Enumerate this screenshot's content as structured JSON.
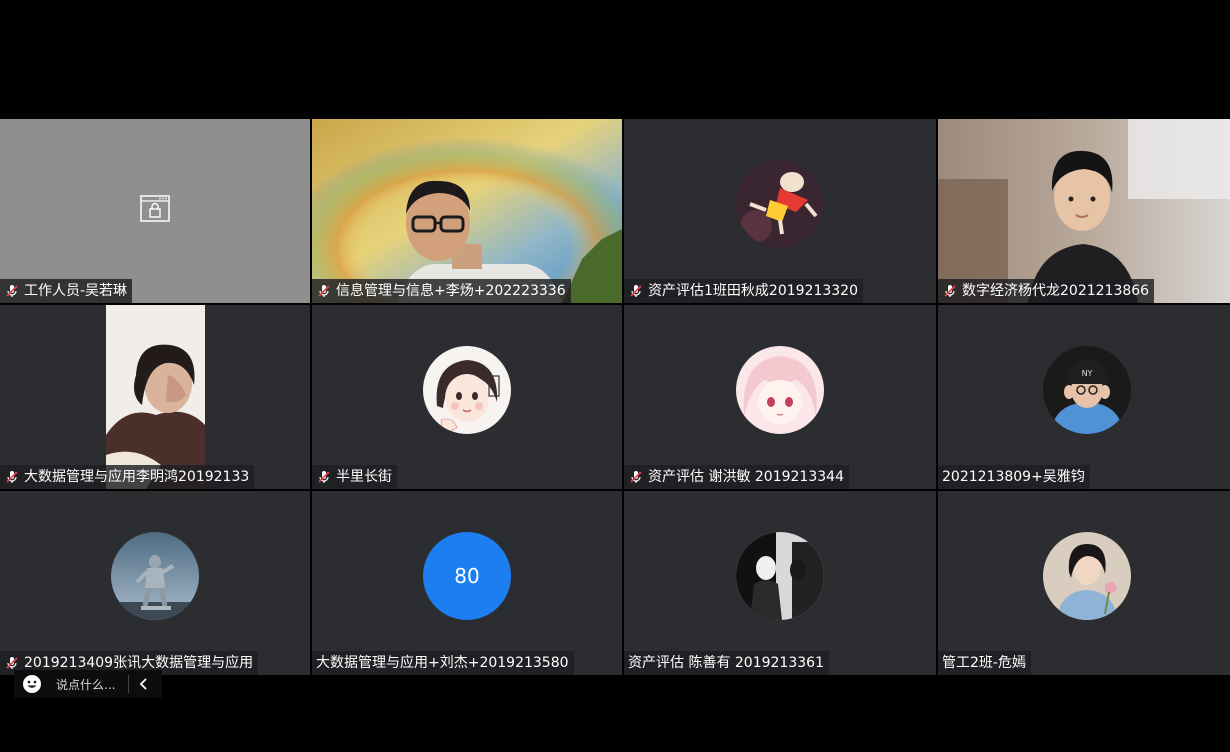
{
  "participants": [
    {
      "name": "工作人员-吴若琳",
      "muted": true
    },
    {
      "name": "信息管理与信息+李炀+202223336",
      "muted": true
    },
    {
      "name": "资产评估1班田秋成2019213320",
      "muted": true
    },
    {
      "name": "数字经济杨代龙2021213866",
      "muted": true
    },
    {
      "name": "大数据管理与应用李明鸿20192133",
      "muted": true
    },
    {
      "name": "半里长街",
      "muted": true
    },
    {
      "name": "资产评估 谢洪敏  2019213344",
      "muted": true
    },
    {
      "name": "2021213809+吴雅钧",
      "muted": false
    },
    {
      "name": "2019213409张讯大数据管理与应用",
      "muted": true
    },
    {
      "name": "大数据管理与应用+刘杰+2019213580",
      "muted": false,
      "avatar_text": "80"
    },
    {
      "name": "资产评估 陈善有 2019213361",
      "muted": false
    },
    {
      "name": "管工2班-危嫣",
      "muted": false
    }
  ],
  "chat": {
    "placeholder": "说点什么..."
  },
  "colors": {
    "tile_bg": "#2b2d31",
    "locked_tile_bg": "#8f8f8f",
    "avatar_blue": "#1c7ef1",
    "muted_mic": "#e0434b"
  }
}
